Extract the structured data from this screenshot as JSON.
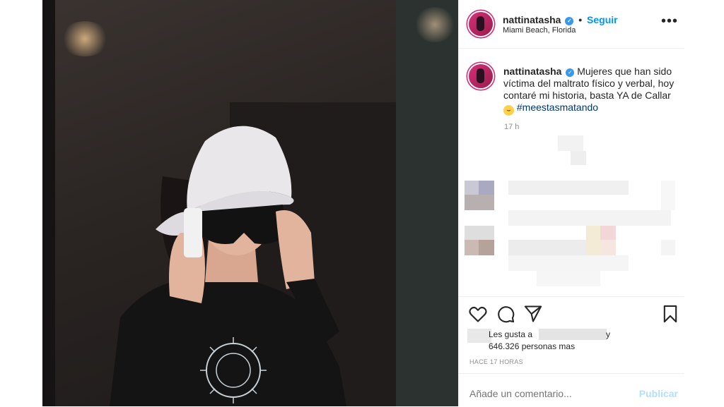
{
  "post": {
    "photo_description_icon": "photo",
    "header": {
      "username": "nattinatasha",
      "verified_icon": "verified-check-icon",
      "separator": "•",
      "follow_label": "Seguir",
      "location": "Miami Beach, Florida",
      "more_icon": "more-icon",
      "more_label": "•••"
    },
    "caption": {
      "username": "nattinatasha",
      "text": "Mujeres que han sido víctima del maltrato físico y verbal, hoy contaré mi historia, basta YA de Callar",
      "emoji": "😬",
      "hashtag": "#meestasmatando",
      "time": "17 h"
    },
    "actions": {
      "like_icon": "heart-icon",
      "comment_icon": "comment-icon",
      "share_icon": "share-icon",
      "save_icon": "bookmark-icon"
    },
    "likes": {
      "prefix": "Les gusta a",
      "suffix": "y",
      "count_text": "646.326 personas mas"
    },
    "timestamp": "HACE 17 HORAS",
    "comment": {
      "placeholder": "Añade un comentario...",
      "publish_label": "Publicar"
    },
    "colors": {
      "link_blue": "#0095f6",
      "hashtag": "#00376b",
      "muted": "#8e8e8e",
      "publish_disabled": "#b2dffc"
    }
  }
}
